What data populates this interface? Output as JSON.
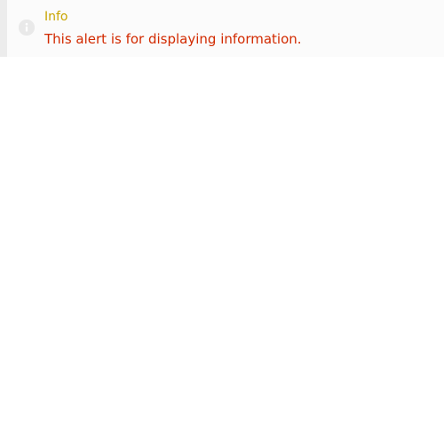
{
  "alert": {
    "icon": "info-icon",
    "title": "Info",
    "message": "This alert is for displaying information.",
    "colors": {
      "title": "#c9a500",
      "message": "#d22a00",
      "background": "#fbfbfb",
      "accent_bar": "#ececec",
      "icon": "#e9e9e9"
    }
  }
}
